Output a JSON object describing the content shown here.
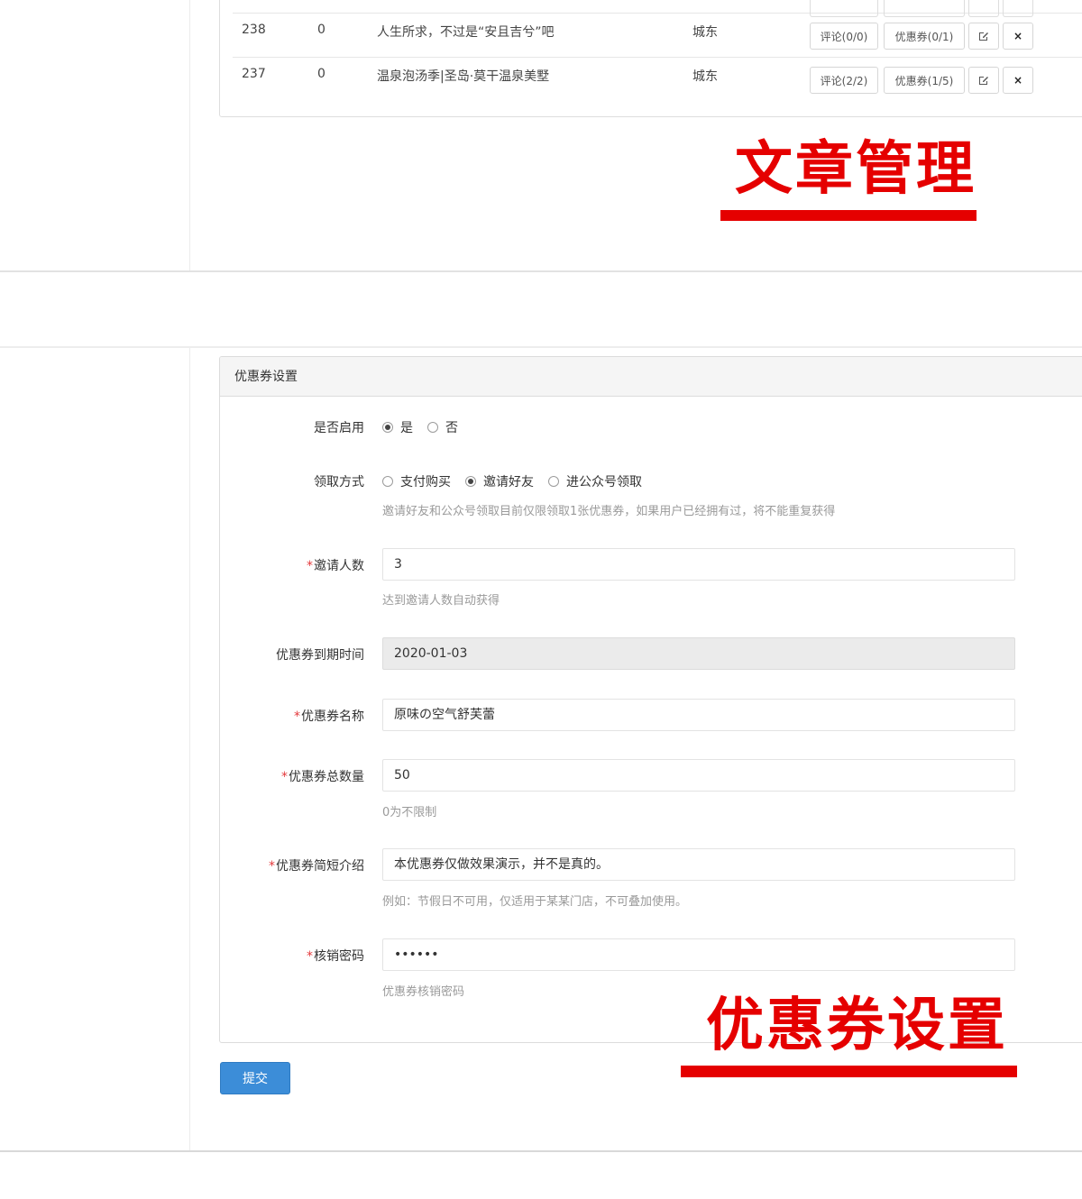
{
  "article_table": {
    "rows": [
      {
        "id": "238",
        "count": "0",
        "title": "人生所求，不过是“安且吉兮”吧",
        "area": "城东",
        "comment_btn": "评论(0/0)",
        "coupon_btn": "优惠券(0/1)",
        "edit_icon": "edit-icon",
        "delete_icon": "close-icon",
        "delete_label": "×"
      },
      {
        "id": "237",
        "count": "0",
        "title": "温泉泡汤季|圣岛·莫干温泉美墅",
        "area": "城东",
        "comment_btn": "评论(2/2)",
        "coupon_btn": "优惠券(1/5)",
        "edit_icon": "edit-icon",
        "delete_icon": "close-icon",
        "delete_label": "×"
      }
    ]
  },
  "captions": {
    "top": "文章管理",
    "bottom": "优惠券设置"
  },
  "coupon_form": {
    "header": "优惠券设置",
    "enable": {
      "label": "是否启用",
      "options": [
        {
          "label": "是",
          "checked": true
        },
        {
          "label": "否",
          "checked": false
        }
      ]
    },
    "method": {
      "label": "领取方式",
      "options": [
        {
          "label": "支付购买",
          "checked": false
        },
        {
          "label": "邀请好友",
          "checked": true
        },
        {
          "label": "进公众号领取",
          "checked": false
        }
      ],
      "help": "邀请好友和公众号领取目前仅限领取1张优惠券，如果用户已经拥有过，将不能重复获得"
    },
    "invite_count": {
      "label": "邀请人数",
      "value": "3",
      "help": "达到邀请人数自动获得"
    },
    "expire": {
      "label": "优惠券到期时间",
      "value": "2020-01-03"
    },
    "name": {
      "label": "优惠券名称",
      "value": "原味の空气舒芙蕾"
    },
    "total": {
      "label": "优惠券总数量",
      "value": "50",
      "help": "0为不限制"
    },
    "intro": {
      "label": "优惠券简短介绍",
      "value": "本优惠券仅做效果演示，并不是真的。",
      "help": "例如：节假日不可用，仅适用于某某门店，不可叠加使用。"
    },
    "password": {
      "label": "核销密码",
      "value": "••••••",
      "help": "优惠券核销密码"
    },
    "required_mark": "*",
    "submit": "提交"
  }
}
